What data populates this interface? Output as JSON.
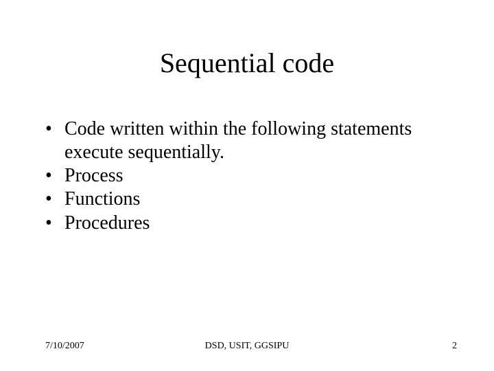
{
  "title": "Sequential code",
  "bullets": [
    "Code written within the following statements execute sequentially.",
    "Process",
    "Functions",
    "Procedures"
  ],
  "footer": {
    "date": "7/10/2007",
    "center": "DSD, USIT, GGSIPU",
    "page": "2"
  }
}
